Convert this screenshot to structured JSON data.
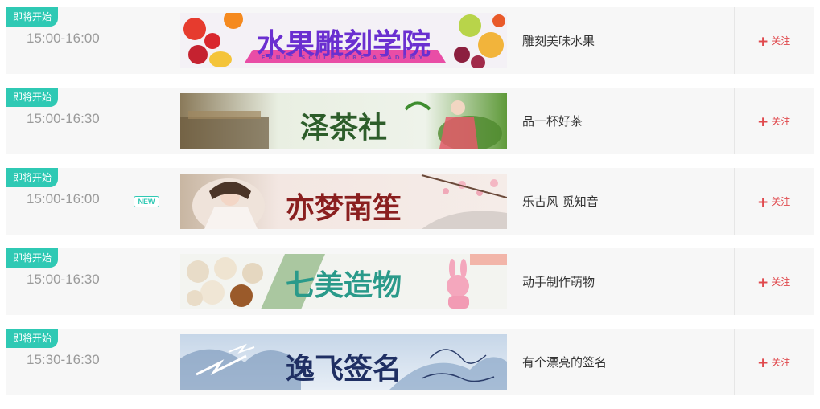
{
  "follow_label": "关注",
  "follow_plus": "+",
  "colors": {
    "badge": "#2fc9b4",
    "follow": "#e0494d",
    "time": "#9a9a9a"
  },
  "items": [
    {
      "badge": "即将开始",
      "time": "15:00-16:00",
      "new": "",
      "banner_title": "水果雕刻学院",
      "banner_sub": "FRUIT SCULPTURE ACADEMY",
      "desc": "雕刻美味水果"
    },
    {
      "badge": "即将开始",
      "time": "15:00-16:30",
      "new": "",
      "banner_title": "泽茶社",
      "banner_sub": "",
      "desc": "品一杯好茶"
    },
    {
      "badge": "即将开始",
      "time": "15:00-16:00",
      "new": "NEW",
      "banner_title": "亦梦南笙",
      "banner_sub": "",
      "desc": "乐古风 觅知音"
    },
    {
      "badge": "即将开始",
      "time": "15:00-16:30",
      "new": "",
      "banner_title": "七美造物",
      "banner_sub": "",
      "desc": "动手制作萌物"
    },
    {
      "badge": "即将开始",
      "time": "15:30-16:30",
      "new": "",
      "banner_title": "逸飞签名",
      "banner_sub": "",
      "desc": "有个漂亮的签名"
    }
  ]
}
